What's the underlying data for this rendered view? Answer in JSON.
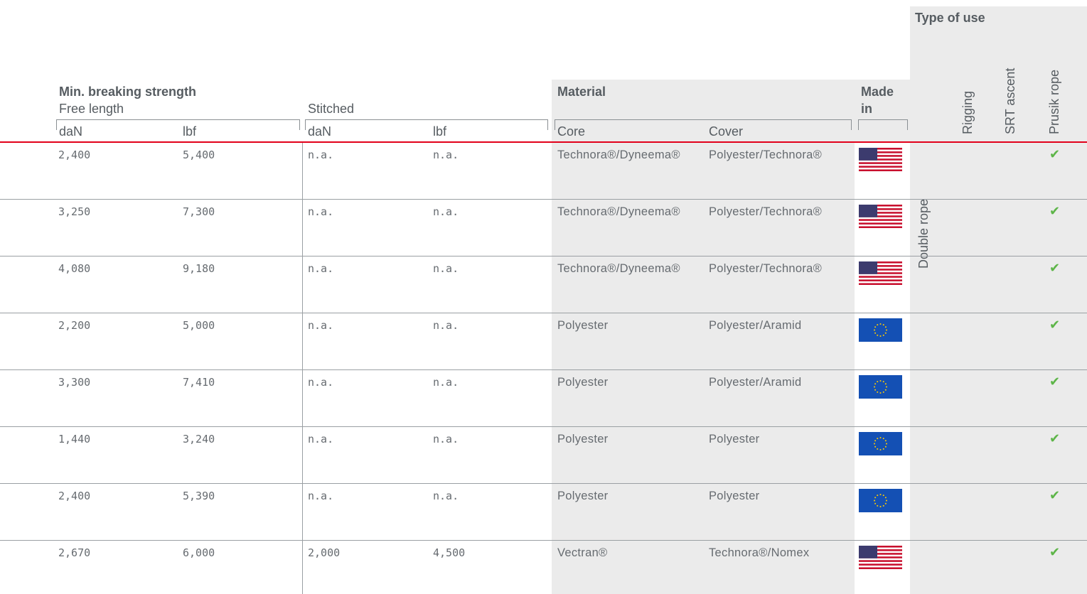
{
  "headers": {
    "strength_title": "Min. breaking strength",
    "free_length": "Free length",
    "stitched": "Stitched",
    "dan": "daN",
    "lbf": "lbf",
    "material": "Material",
    "core": "Core",
    "cover": "Cover",
    "made_in_line1": "Made",
    "made_in_line2": "in",
    "type_of_use": "Type of use",
    "use_double": "Double rope",
    "use_rigging": "Rigging",
    "use_srt": "SRT ascent",
    "use_prusik": "Prusik rope"
  },
  "rows": [
    {
      "free_dan": "2,400",
      "free_lbf": "5,400",
      "st_dan": "n.a.",
      "st_lbf": "n.a.",
      "core": "Technora®/Dyneema®",
      "cover": "Polyester/Technora®",
      "made_in": "us-flag",
      "check": "✔"
    },
    {
      "free_dan": "3,250",
      "free_lbf": "7,300",
      "st_dan": "n.a.",
      "st_lbf": "n.a.",
      "core": "Technora®/Dyneema®",
      "cover": "Polyester/Technora®",
      "made_in": "us-flag",
      "check": "✔"
    },
    {
      "free_dan": "4,080",
      "free_lbf": "9,180",
      "st_dan": "n.a.",
      "st_lbf": "n.a.",
      "core": "Technora®/Dyneema®",
      "cover": "Polyester/Technora®",
      "made_in": "us-flag",
      "check": "✔"
    },
    {
      "free_dan": "2,200",
      "free_lbf": "5,000",
      "st_dan": "n.a.",
      "st_lbf": "n.a.",
      "core": "Polyester",
      "cover": "Polyester/Aramid",
      "made_in": "eu-flag",
      "check": "✔"
    },
    {
      "free_dan": "3,300",
      "free_lbf": "7,410",
      "st_dan": "n.a.",
      "st_lbf": "n.a.",
      "core": "Polyester",
      "cover": "Polyester/Aramid",
      "made_in": "eu-flag",
      "check": "✔"
    },
    {
      "free_dan": "1,440",
      "free_lbf": "3,240",
      "st_dan": "n.a.",
      "st_lbf": "n.a.",
      "core": "Polyester",
      "cover": "Polyester",
      "made_in": "eu-flag",
      "check": "✔"
    },
    {
      "free_dan": "2,400",
      "free_lbf": "5,390",
      "st_dan": "n.a.",
      "st_lbf": "n.a.",
      "core": "Polyester",
      "cover": "Polyester",
      "made_in": "eu-flag",
      "check": "✔"
    },
    {
      "free_dan": "2,670",
      "free_lbf": "6,000",
      "st_dan": "2,000",
      "st_lbf": "4,500",
      "core": "Vectran®",
      "cover": "Technora®/Nomex",
      "made_in": "us-flag",
      "check": "✔"
    }
  ],
  "colors": {
    "accent_line": "#e2001a",
    "check": "#5db548",
    "shaded": "#ebebeb"
  }
}
